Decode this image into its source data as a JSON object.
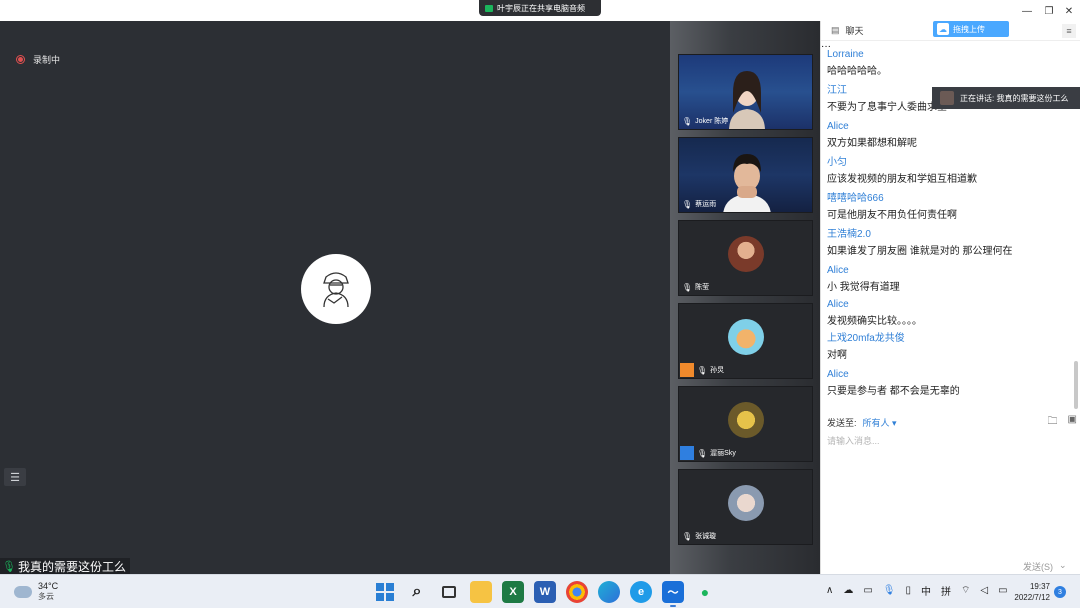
{
  "share_banner": {
    "text": "叶宇辰正在共享电脑音频"
  },
  "window_controls": {
    "minimize": "—",
    "restore": "❐",
    "close": "✕"
  },
  "stage": {
    "recording_label": "录制中",
    "caption_text": "我真的需要这份工么",
    "list_icon": "☰"
  },
  "participants": [
    {
      "name": "Joker 陈婷",
      "type": "video"
    },
    {
      "name": "蔡运雨",
      "type": "video"
    },
    {
      "name": "陈莹",
      "type": "avatar"
    },
    {
      "name": "孙炅",
      "type": "avatar"
    },
    {
      "name": "渥丽Sky",
      "type": "avatar"
    },
    {
      "name": "张诚璇",
      "type": "avatar"
    }
  ],
  "chat": {
    "title": "聊天",
    "upload_label": "拖拽上传",
    "menu_icon": "≡",
    "messages": [
      {
        "sender": "Lorraine",
        "text": "哈哈哈哈哈。"
      },
      {
        "sender": "江江",
        "text": "不要为了息事宁人委曲求全"
      },
      {
        "sender": "Alice",
        "text": "双方如果都想和解呢"
      },
      {
        "sender": "小匀",
        "text": "应该发视频的朋友和学姐互相道歉"
      },
      {
        "sender": "嘻嘻哈哈666",
        "text": "可是他朋友不用负任何责任啊"
      },
      {
        "sender": "王浩楠2.0",
        "text": "如果谁发了朋友圈 谁就是对的 那公理何在"
      },
      {
        "sender": "Alice",
        "text": "小 我觉得有道理"
      },
      {
        "sender": "Alice",
        "text": "发视频确实比较。。。。"
      },
      {
        "sender": "上戏20mfa龙共俊",
        "text": "对啊"
      },
      {
        "sender": "Alice",
        "text": "只要是参与者 都不会是无辜的"
      }
    ],
    "send_to_label": "发送至:",
    "send_to_value": "所有人 ▾",
    "input_placeholder": "请输入消息...",
    "send_button": "发送(S)"
  },
  "speaking_toast": {
    "text": "正在讲话: 我真的需要这份工么"
  },
  "taskbar": {
    "weather_temp": "34°C",
    "weather_desc": "多云",
    "time": "19:37",
    "date": "2022/7/12",
    "notification_count": "3",
    "ime_lang": "中",
    "ime_mode": "拼",
    "tray_chevron": "∧"
  }
}
